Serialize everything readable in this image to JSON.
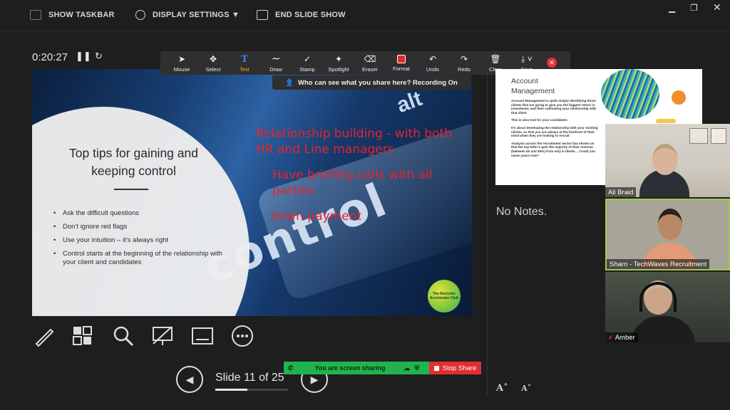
{
  "topbar": {
    "show_taskbar": "SHOW TASKBAR",
    "display_settings": "DISPLAY SETTINGS ▼",
    "end_slide_show": "END SLIDE SHOW"
  },
  "timer": {
    "elapsed": "0:20:27"
  },
  "zoom_toolbar": {
    "tools": [
      {
        "label": "Mouse",
        "icon": "mouse-pointer-icon",
        "glyph": "➤"
      },
      {
        "label": "Select",
        "icon": "move-icon",
        "glyph": "✥"
      },
      {
        "label": "Text",
        "icon": "text-icon",
        "glyph": "T"
      },
      {
        "label": "Draw",
        "icon": "draw-icon",
        "glyph": "∼"
      },
      {
        "label": "Stamp",
        "icon": "stamp-icon",
        "glyph": "✓"
      },
      {
        "label": "Spotlight",
        "icon": "spotlight-icon",
        "glyph": "✦"
      },
      {
        "label": "Eraser",
        "icon": "eraser-icon",
        "glyph": "⌫"
      },
      {
        "label": "Format",
        "icon": "format-icon",
        "glyph": ""
      },
      {
        "label": "Undo",
        "icon": "undo-icon",
        "glyph": "↶"
      },
      {
        "label": "Redo",
        "icon": "redo-icon",
        "glyph": "↷"
      },
      {
        "label": "Clear",
        "icon": "trash-icon",
        "glyph": "🗑"
      },
      {
        "label": "Save",
        "icon": "save-icon",
        "glyph": "⤓"
      }
    ],
    "active_tool": "Text",
    "recording_notice": "Who can see what you share here? Recording On"
  },
  "slide": {
    "title": "Top tips for gaining and keeping control",
    "bullets": [
      "Ask the difficult questions",
      "Don’t ignore red flags",
      "Use your intuition – it’s always right",
      "Control starts at the beginning of the relationship with your client and candidates"
    ],
    "key_text": "control",
    "key_alt": "alt",
    "logo_text": "The Recruiter Accelerator Club",
    "annotations": [
      "Relationship building - with both HR and Line managers",
      "Have briefing calls with all parties",
      "down payment"
    ]
  },
  "navigation": {
    "slide_label": "Slide 11 of 25",
    "current": 11,
    "total": 25
  },
  "share_bar": {
    "status": "You are screen sharing",
    "stop": "Stop Share"
  },
  "next_slide": {
    "title": "Account Management",
    "paragraphs": [
      "Account Management is quite simply identifying those clients that are going to give you the biggest return in investment, and then cultivating your relationship with that client",
      "This is also true for your candidates",
      "It’s about developing the relationship with your existing clients, so that you are always at the forefront of their mind when they are looking to recruit",
      "Analysis across the recruitment sector has shown us that the top biller’s gain the majority of their revenue (between 50 and 95%) from only 5 clients… Could you name yours now?"
    ]
  },
  "notes": {
    "text": "No Notes."
  },
  "participants": [
    {
      "name": "Ali Braid",
      "muted": false
    },
    {
      "name": "Sharn - TechWaves Recruitment",
      "muted": false
    },
    {
      "name": "Amber",
      "muted": true
    }
  ],
  "colors": {
    "annotation_red": "#e8232c",
    "share_green": "#21b34e",
    "stop_red": "#e02f2f",
    "active_tool": "#f5a623"
  }
}
